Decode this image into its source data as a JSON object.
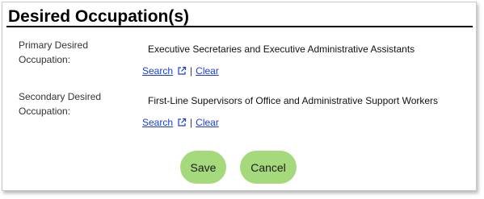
{
  "section": {
    "title": "Desired Occupation(s)"
  },
  "primary": {
    "label": "Primary Desired Occupation:",
    "value": "Executive Secretaries and Executive Administrative Assistants",
    "search_label": "Search",
    "separator": "|",
    "clear_label": "Clear"
  },
  "secondary": {
    "label": "Secondary Desired Occupation:",
    "value": "First-Line Supervisors of Office and Administrative Support Workers",
    "search_label": "Search",
    "separator": "|",
    "clear_label": "Clear"
  },
  "actions": {
    "save_label": "Save",
    "cancel_label": "Cancel"
  },
  "colors": {
    "link": "#1a3fd6",
    "button_bg": "#a4d97c",
    "rule": "#000000"
  },
  "icons": {
    "search_external": "external-link-icon"
  }
}
